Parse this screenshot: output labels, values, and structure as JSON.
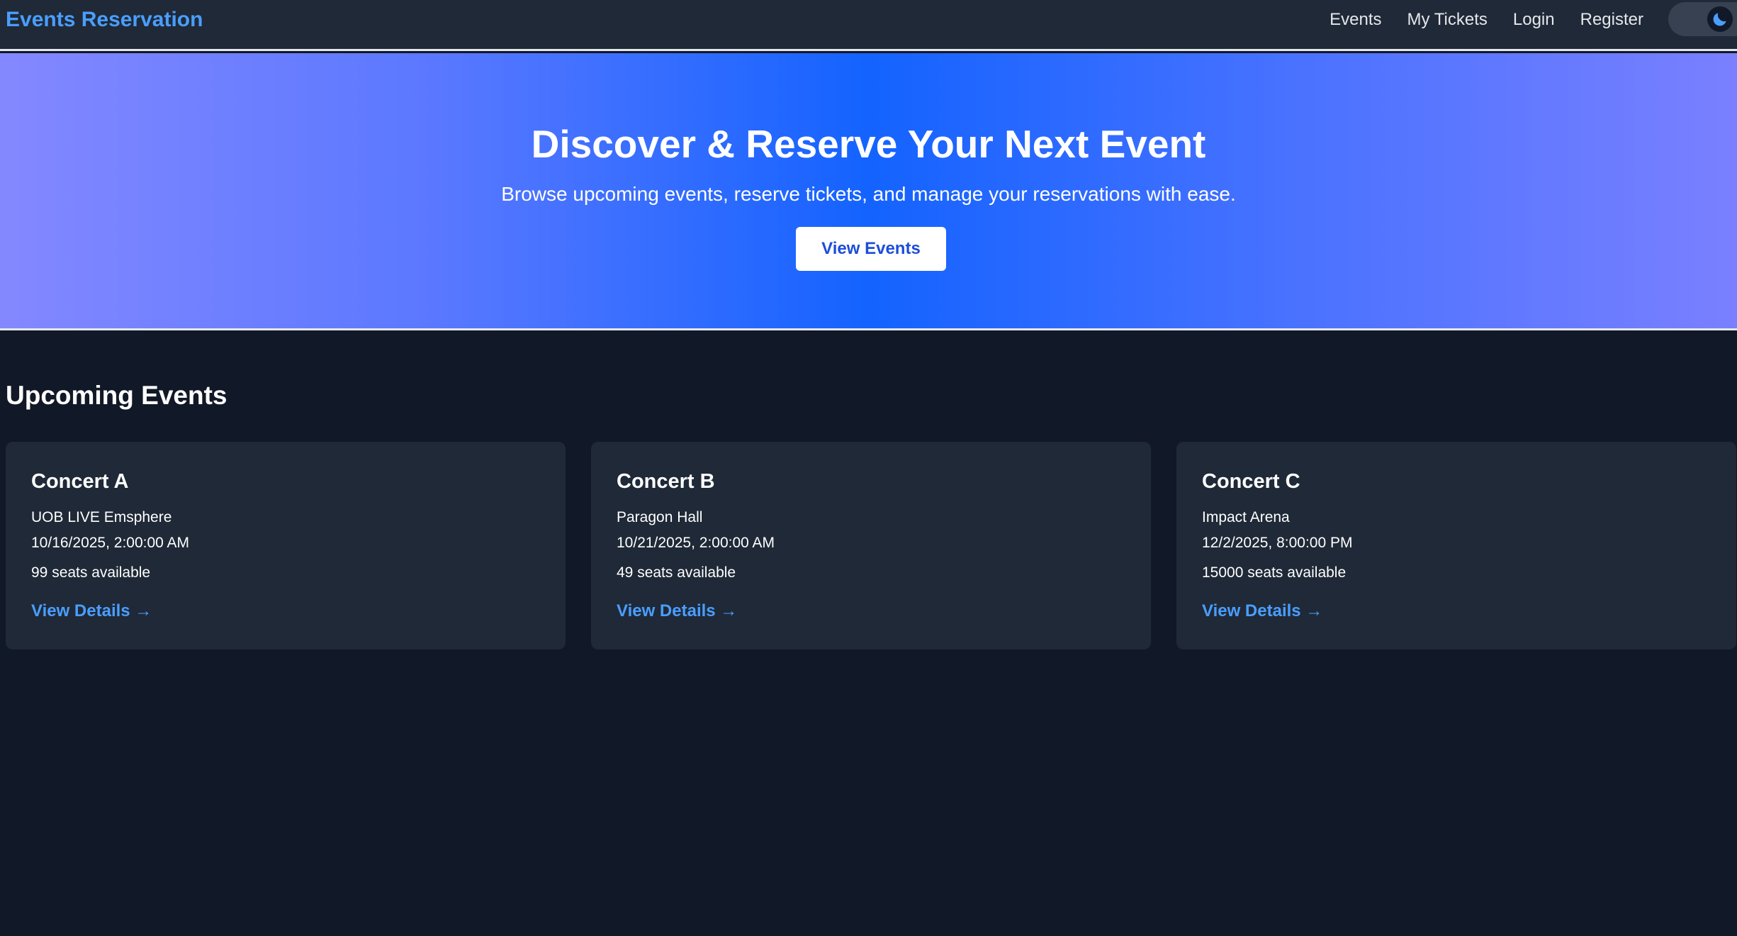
{
  "navbar": {
    "brand": "Events Reservation",
    "links": [
      "Events",
      "My Tickets",
      "Login",
      "Register"
    ]
  },
  "hero": {
    "title": "Discover & Reserve Your Next Event",
    "subtitle": "Browse upcoming events, reserve tickets, and manage your reservations with ease.",
    "button_label": "View Events"
  },
  "events_section": {
    "title": "Upcoming Events",
    "link_label": "View Details →",
    "events": [
      {
        "title": "Concert A",
        "venue": "UOB LIVE Emsphere",
        "date": "10/16/2025, 2:00:00 AM",
        "seats": "99 seats available"
      },
      {
        "title": "Concert B",
        "venue": "Paragon Hall",
        "date": "10/21/2025, 2:00:00 AM",
        "seats": "49 seats available"
      },
      {
        "title": "Concert C",
        "venue": "Impact Arena",
        "date": "12/2/2025, 8:00:00 PM",
        "seats": "15000 seats available"
      }
    ]
  },
  "theme": {
    "toggle_icon": "moon-icon",
    "brand_color": "#4a9eff",
    "accent_blue": "#1463ff"
  }
}
